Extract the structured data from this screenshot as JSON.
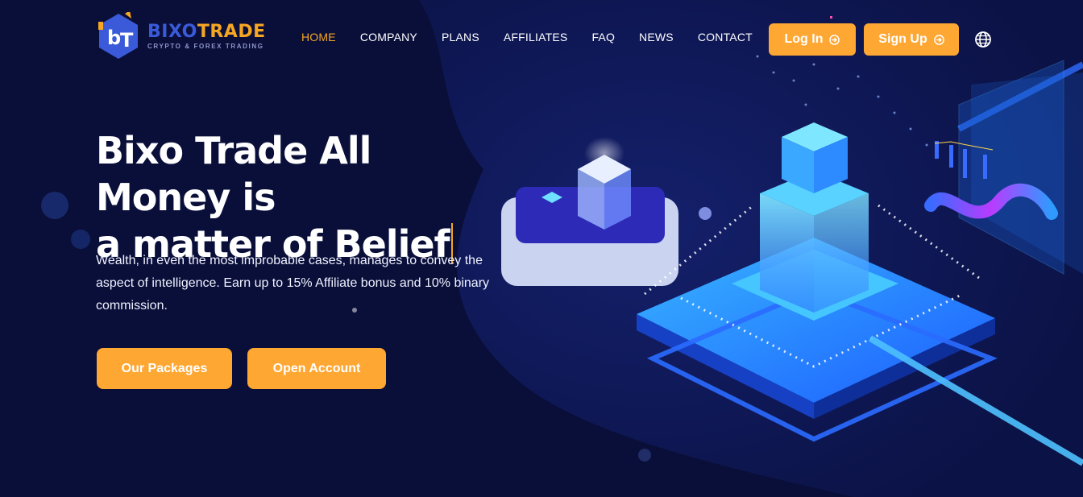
{
  "brand": {
    "name_part1": "BIXO",
    "name_part2": "TRADE",
    "tagline": "CRYPTO & FOREX TRADING"
  },
  "nav": {
    "items": [
      {
        "label": "HOME",
        "active": true
      },
      {
        "label": "COMPANY",
        "active": false
      },
      {
        "label": "PLANS",
        "active": false
      },
      {
        "label": "AFFILIATES",
        "active": false
      },
      {
        "label": "FAQ",
        "active": false
      },
      {
        "label": "NEWS",
        "active": false
      },
      {
        "label": "CONTACT",
        "active": false
      }
    ],
    "login_label": "Log In",
    "signup_label": "Sign Up",
    "button_icon": "sign-in-arrow-icon",
    "language_icon": "globe-icon"
  },
  "hero": {
    "headline_line1": "Bixo Trade All Money is",
    "headline_line2": "a matter of Belief",
    "description": "Wealth, in even the most improbable cases, manages to convey the aspect of intelligence. Earn up to 15% Affiliate bonus and 10% binary commission.",
    "primary_cta": "Our Packages",
    "secondary_cta": "Open Account"
  },
  "colors": {
    "background": "#0a0f3a",
    "accent": "#ffa733",
    "active_nav": "#f5a623",
    "logo_blue": "#3a5ad9"
  }
}
